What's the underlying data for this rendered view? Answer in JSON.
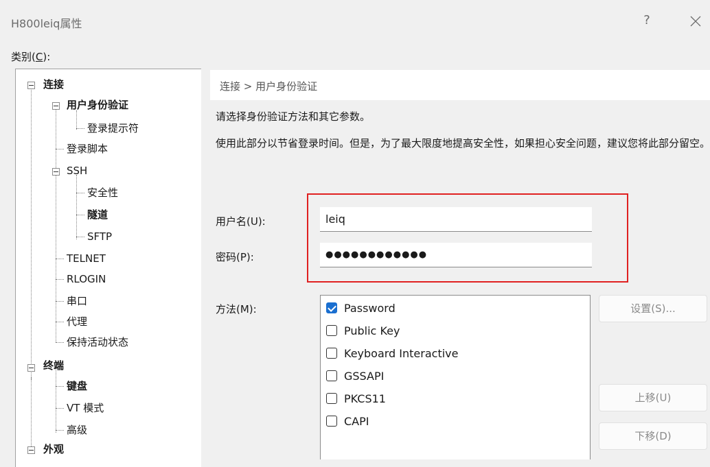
{
  "window": {
    "title": "H800leiq属性",
    "help_label": "?"
  },
  "category_label_pre": "类别(",
  "category_label_key": "C",
  "category_label_post": "):",
  "tree": [
    {
      "label": "连接",
      "bold": true
    },
    {
      "label": "用户身份验证",
      "bold": true
    },
    {
      "label": "登录提示符",
      "bold": false
    },
    {
      "label": "登录脚本",
      "bold": false
    },
    {
      "label": "SSH",
      "bold": false
    },
    {
      "label": "安全性",
      "bold": false
    },
    {
      "label": "隧道",
      "bold": true
    },
    {
      "label": "SFTP",
      "bold": false
    },
    {
      "label": "TELNET",
      "bold": false
    },
    {
      "label": "RLOGIN",
      "bold": false
    },
    {
      "label": "串口",
      "bold": false
    },
    {
      "label": "代理",
      "bold": false
    },
    {
      "label": "保持活动状态",
      "bold": false
    },
    {
      "label": "终端",
      "bold": true
    },
    {
      "label": "键盘",
      "bold": true
    },
    {
      "label": "VT 模式",
      "bold": false
    },
    {
      "label": "高级",
      "bold": false
    },
    {
      "label": "外观",
      "bold": true
    }
  ],
  "main": {
    "breadcrumb": "连接 > 用户身份验证",
    "description1": "请选择身份验证方法和其它参数。",
    "description2": "使用此部分以节省登录时间。但是，为了最大限度地提高安全性，如果担心安全问题，建议您将此部分留空。",
    "username_label": "用户名(U):",
    "username_value": "leiq",
    "password_label": "密码(P):",
    "password_value": "●●●●●●●●●●●●",
    "method_label": "方法(M):",
    "methods": [
      {
        "label": "Password",
        "checked": true
      },
      {
        "label": "Public Key",
        "checked": false
      },
      {
        "label": "Keyboard Interactive",
        "checked": false
      },
      {
        "label": "GSSAPI",
        "checked": false
      },
      {
        "label": "PKCS11",
        "checked": false
      },
      {
        "label": "CAPI",
        "checked": false
      }
    ],
    "settings_button": "设置(S)...",
    "move_up_button": "上移(U)",
    "move_down_button": "下移(D)"
  },
  "colors": {
    "highlight": "#e02020",
    "checkbox_checked": "#1a6fd0"
  }
}
